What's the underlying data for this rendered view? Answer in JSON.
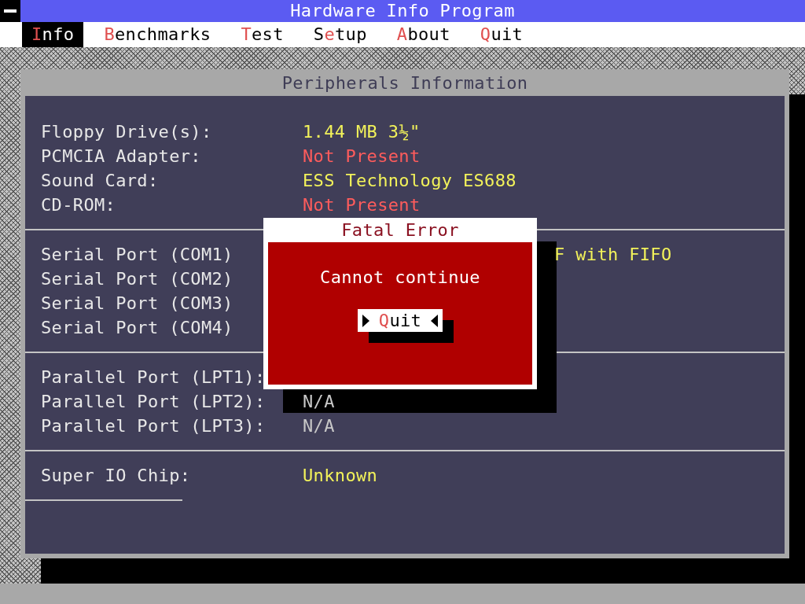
{
  "window": {
    "title": "Hardware Info Program"
  },
  "menu": [
    {
      "label": "**I**nfo",
      "selected": true
    },
    {
      "label": "**B**enchmarks",
      "selected": false
    },
    {
      "label": "**T**est",
      "selected": false
    },
    {
      "label": "S**e**tup",
      "selected": false
    },
    {
      "label": "**A**bout",
      "selected": false
    },
    {
      "label": "**Q**uit",
      "selected": false
    }
  ],
  "panel": {
    "title": "Peripherals Information",
    "sections": [
      {
        "rows": [
          {
            "label": "Floppy Drive(s):",
            "value": "1.44 MB 3½\"",
            "color": "#f2f25a",
            "kind": "full"
          },
          {
            "label": "PCMCIA Adapter:",
            "value": "Not Present",
            "color": "#ff5c5c",
            "kind": "full"
          },
          {
            "label": "Sound Card:",
            "value": "ESS Technology ES688",
            "color": "#f2f25a",
            "kind": "full"
          },
          {
            "label": "CD-ROM:",
            "value": "Not Present",
            "color": "#ff5c5c",
            "kind": "full"
          }
        ]
      },
      {
        "rows": [
          {
            "label": "Serial Port (COM1)",
            "value": "F with FIFO",
            "color": "#f2f25a",
            "kind": "clipped"
          },
          {
            "label": "Serial Port (COM2)"
          },
          {
            "label": "Serial Port (COM3)"
          },
          {
            "label": "Serial Port (COM4)"
          }
        ]
      },
      {
        "rows": [
          {
            "label": "Parallel Port (LPT1):"
          },
          {
            "label": "Parallel Port (LPT2):",
            "value": "N/A",
            "color": "#c8c8c8",
            "kind": "full"
          },
          {
            "label": "Parallel Port (LPT3):",
            "value": "N/A",
            "color": "#c8c8c8",
            "kind": "full"
          }
        ]
      },
      {
        "rows": [
          {
            "label": "Super IO Chip:",
            "value": "Unknown",
            "color": "#f2f25a",
            "kind": "full"
          }
        ]
      }
    ]
  },
  "dialog": {
    "title": "Fatal Error",
    "message": "Cannot continue",
    "button": "**Q**uit"
  }
}
